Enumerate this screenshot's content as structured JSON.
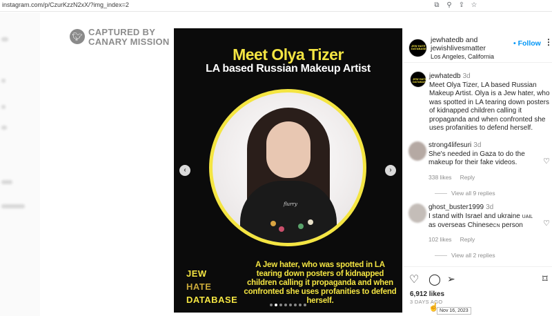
{
  "browser": {
    "url": "instagram.com/p/CzurKzzN2xX/?img_index=2",
    "icons": [
      "translate-icon",
      "zoom-icon",
      "share-icon",
      "star-icon"
    ]
  },
  "watermark": {
    "line1": "CAPTURED BY",
    "line2": "CANARY MISSION"
  },
  "post_image": {
    "title": "Meet Olya Tizer",
    "subtitle": "LA based Russian Makeup Artist",
    "badge_lines": [
      "JEW",
      "HATE",
      "DATABASE"
    ],
    "caption": "A Jew hater, who was spotted in LA tearing down posters of kidnapped children calling it propaganda and when confronted she uses profanities to defend herself.",
    "shirt_text": "flurry",
    "dot_count": 8,
    "active_dot": 1,
    "accent_color": "#f4e542"
  },
  "header": {
    "user1": "jewhatedb",
    "and_text": " and",
    "user2": "jewishlivesmatter",
    "location": "Los Angeles, California",
    "follow_label": "• Follow",
    "more_label": "⋮",
    "avatar_text": "JEW HATE DATABASE"
  },
  "caption_post": {
    "username": "jewhatedb",
    "time": "3d",
    "text": "Meet Olya Tizer, LA based Russian Makeup Artist. Olya is a Jew hater, who was spotted in LA tearing down posters of kidnapped children calling it propaganda and when confronted she uses profanities to defend herself."
  },
  "comments": [
    {
      "username": "strong4lifesuri",
      "time": "3d",
      "text": "She's needed in Gaza to do the makeup for their fake videos.",
      "likes": "338 likes",
      "reply_label": "Reply",
      "view_replies": "View all 9 replies"
    },
    {
      "username": "ghost_buster1999",
      "time": "3d",
      "text_before": "I stand with Israel and ukraine ",
      "tag1": "UAIL",
      "text_mid": " as overseas Chinese",
      "tag2": "CN",
      "text_after": " person",
      "likes": "102 likes",
      "reply_label": "Reply",
      "view_replies": "View all 2 replies"
    }
  ],
  "actions": {
    "likes": "6,912 likes",
    "ago": "3 DAYS AGO",
    "tooltip": "Nov 16, 2023"
  }
}
